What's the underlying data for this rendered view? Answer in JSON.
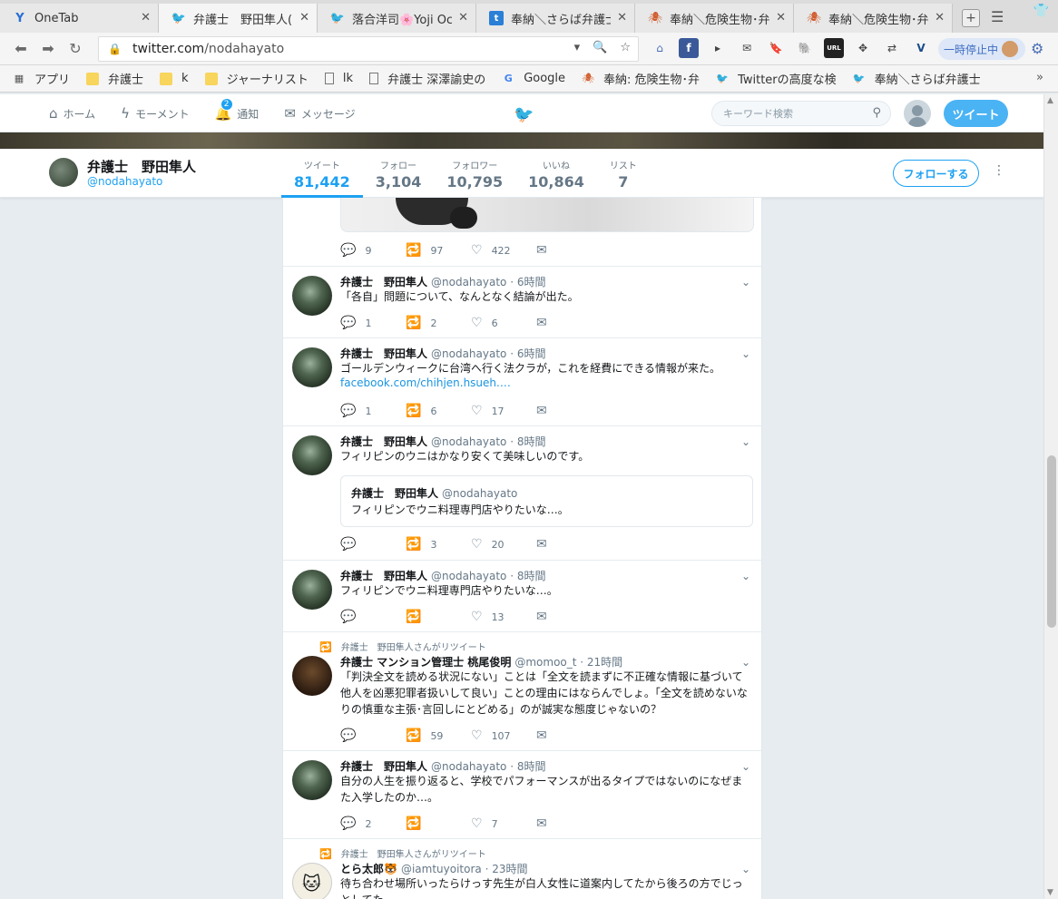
{
  "browser": {
    "tabs": [
      {
        "title": "OneTab",
        "icon": "onetab-icon"
      },
      {
        "title": "弁護士　野田隼人(",
        "icon": "twitter-icon"
      },
      {
        "title": "落合洋司🌸Yoji Oc",
        "icon": "twitter-icon"
      },
      {
        "title": "奉納＼さらば弁護士",
        "icon": "t-icon"
      },
      {
        "title": "奉納＼危険生物･弁",
        "icon": "spider-icon"
      },
      {
        "title": "奉納＼危険生物･弁",
        "icon": "spider-icon"
      }
    ],
    "url_host": "twitter.com",
    "url_path": "/nodahayato",
    "pause_label": "一時停止中",
    "bookmarks": [
      {
        "label": "アプリ",
        "icon": "apps-icon"
      },
      {
        "label": "弁護士",
        "icon": "folder-icon"
      },
      {
        "label": "k",
        "icon": "folder-icon"
      },
      {
        "label": "ジャーナリスト",
        "icon": "folder-icon"
      },
      {
        "label": "lk",
        "icon": "page-icon"
      },
      {
        "label": "弁護士 深澤諭史の",
        "icon": "page-icon"
      },
      {
        "label": "Google",
        "icon": "google-icon"
      },
      {
        "label": "奉納: 危険生物･弁",
        "icon": "spider-icon"
      },
      {
        "label": "Twitterの高度な検",
        "icon": "twitter-icon"
      },
      {
        "label": "奉納＼さらば弁護士",
        "icon": "twitter-icon"
      }
    ]
  },
  "twitter": {
    "nav": {
      "home": "ホーム",
      "moments": "モーメント",
      "notifications": "通知",
      "notifications_count": "2",
      "messages": "メッセージ"
    },
    "search_placeholder": "キーワード検索",
    "tweet_button": "ツイート"
  },
  "profile": {
    "name": "弁護士　野田隼人",
    "handle": "@nodahayato",
    "stats": [
      {
        "label": "ツイート",
        "value": "81,442"
      },
      {
        "label": "フォロー",
        "value": "3,104"
      },
      {
        "label": "フォロワー",
        "value": "10,795"
      },
      {
        "label": "いいね",
        "value": "10,864"
      },
      {
        "label": "リスト",
        "value": "7"
      }
    ],
    "follow_button": "フォローする"
  },
  "timeline": {
    "first_actions": {
      "reply": "9",
      "retweet": "97",
      "like": "422"
    },
    "tweets": [
      {
        "name": "弁護士　野田隼人",
        "meta": "@nodahayato · 6時間",
        "text": "「各自」問題について、なんとなく結論が出た。",
        "reply": "1",
        "retweet": "2",
        "like": "6"
      },
      {
        "name": "弁護士　野田隼人",
        "meta": "@nodahayato · 6時間",
        "text": "ゴールデンウィークに台湾へ行く法クラが，これを経費にできる情報が来た。",
        "link": "facebook.com/chihjen.hsueh.…",
        "reply": "1",
        "retweet": "6",
        "like": "17"
      },
      {
        "name": "弁護士　野田隼人",
        "meta": "@nodahayato · 8時間",
        "text": "フィリピンのウニはかなり安くて美味しいのです。",
        "quote_name": "弁護士　野田隼人",
        "quote_handle": "@nodahayato",
        "quote_text": "フィリピンでウニ料理専門店やりたいな…。",
        "reply": "",
        "retweet": "3",
        "like": "20"
      },
      {
        "name": "弁護士　野田隼人",
        "meta": "@nodahayato · 8時間",
        "text": "フィリピンでウニ料理専門店やりたいな…。",
        "reply": "",
        "retweet": "",
        "like": "13"
      },
      {
        "context": "弁護士　野田隼人さんがリツイート",
        "name": "弁護士 マンション管理士 桃尾俊明",
        "meta": "@momoo_t · 21時間",
        "text": "「判決全文を読める状況にない」ことは「全文を読まずに不正確な情報に基づいて他人を凶悪犯罪者扱いして良い」ことの理由にはならんでしょ。「全文を読めないなりの慎重な主張･言回しにとどめる」のが誠実な態度じゃないの？",
        "reply": "",
        "retweet": "59",
        "like": "107"
      },
      {
        "name": "弁護士　野田隼人",
        "meta": "@nodahayato · 8時間",
        "text": "自分の人生を振り返ると、学校でパフォーマンスが出るタイプではないのになぜまた入学したのか…。",
        "reply": "2",
        "retweet": "",
        "like": "7"
      },
      {
        "context": "弁護士　野田隼人さんがリツイート",
        "name": "とら太郎🐯",
        "meta": "@iamtuyoitora · 23時間",
        "text": "待ち合わせ場所いったらけっす先生が白人女性に道案内してたから後ろの方でじっとしてた"
      }
    ]
  }
}
